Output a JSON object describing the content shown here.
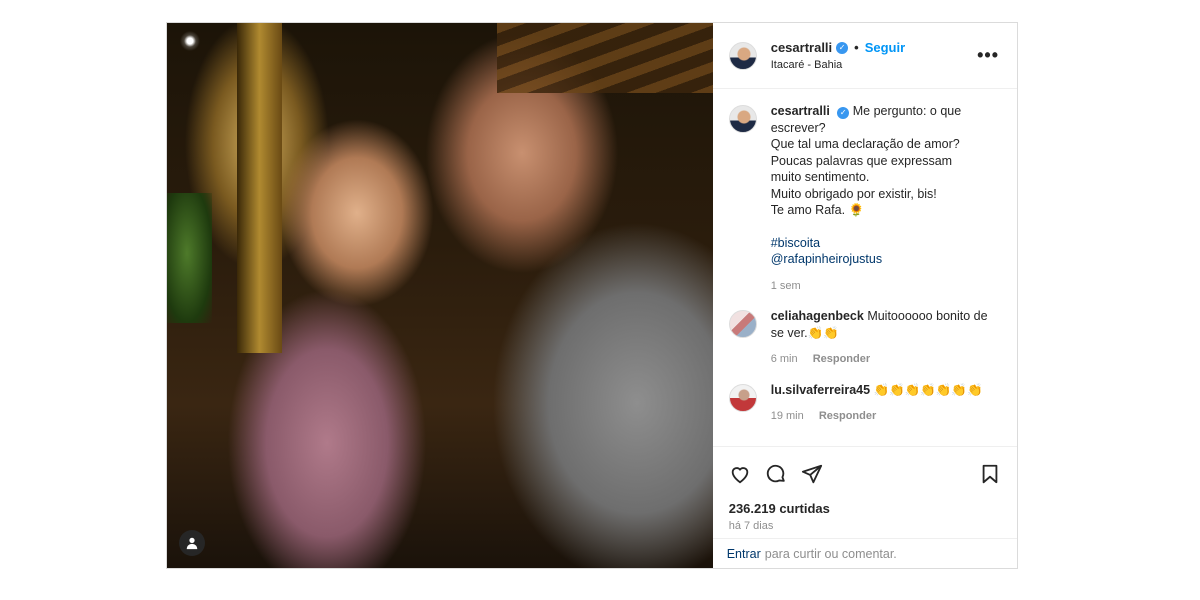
{
  "header": {
    "username": "cesartralli",
    "separator": "•",
    "follow_label": "Seguir",
    "location": "Itacaré - Bahia",
    "more_icon": "•••"
  },
  "caption": {
    "username": "cesartralli",
    "lines": [
      "Me pergunto: o que",
      "escrever?",
      "Que tal uma declaração de amor?",
      "Poucas palavras que expressam",
      "muito sentimento.",
      "Muito obrigado por existir, bis!",
      "Te amo Rafa. 🌻"
    ],
    "hashtag": "#biscoita",
    "mention": "@rafapinheirojustus",
    "time": "1 sem"
  },
  "comments": [
    {
      "username": "celiahagenbeck",
      "text": "Muitoooooo bonito de se ver.👏👏",
      "time": "6 min",
      "reply": "Responder"
    },
    {
      "username": "lu.silvaferreira45",
      "text": "👏👏👏👏👏👏👏",
      "time": "19 min",
      "reply": "Responder"
    }
  ],
  "stats": {
    "likes": "236.219 curtidas",
    "date": "há 7 dias"
  },
  "add_comment": {
    "enter": "Entrar",
    "rest": "para curtir ou comentar."
  },
  "icons": [
    "verified-icon",
    "more-icon",
    "heart-icon",
    "comment-icon",
    "share-icon",
    "bookmark-icon",
    "person-tag-icon"
  ],
  "colors": {
    "link": "#0095f6",
    "tag": "#00376b",
    "muted": "#8e8e8e",
    "border": "#dbdbdb"
  }
}
